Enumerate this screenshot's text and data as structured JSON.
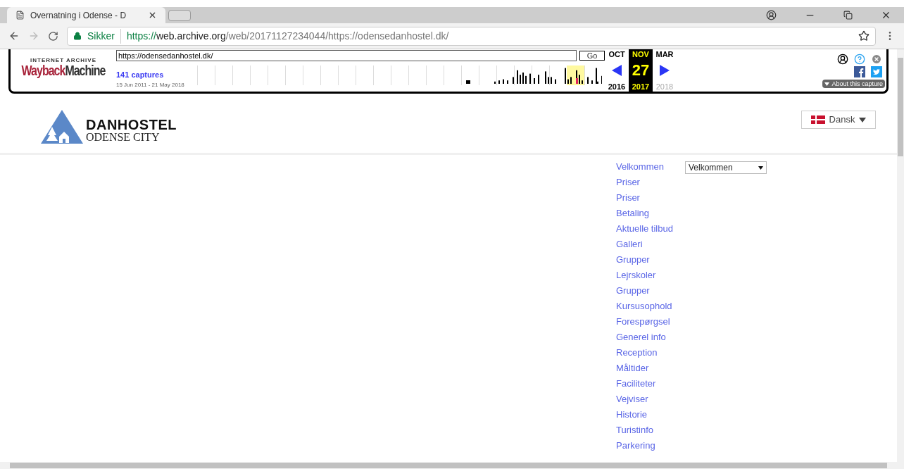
{
  "browser": {
    "tab": {
      "title": "Overnatning i Odense - D"
    },
    "address": {
      "security": "Sikker",
      "scheme": "https://",
      "host": "web.archive.org",
      "path": "/web/20171127234044/https://odensedanhostel.dk/"
    }
  },
  "wayback": {
    "logo_top": "INTERNET ARCHIVE",
    "logo_main": "WaybackMachine",
    "url": "https://odensedanhostel.dk/",
    "go": "Go",
    "captures": "141 captures",
    "range": "15 Jun 2011 - 21 May 2018",
    "calendar": [
      {
        "month": "OCT",
        "year": "2016",
        "selected": false,
        "disabled": false
      },
      {
        "month": "NOV",
        "day": "27",
        "year": "2017",
        "selected": true,
        "disabled": false
      },
      {
        "month": "MAR",
        "year": "2018",
        "selected": false,
        "disabled": true
      }
    ],
    "about": "About this capture"
  },
  "site": {
    "brand": "DANHOSTEL",
    "subtitle": "ODENSE CITY",
    "language": "Dansk",
    "select": "Velkommen",
    "nav": [
      "Velkommen",
      "Priser",
      "Priser",
      "Betaling",
      "Aktuelle tilbud",
      "Galleri",
      "Grupper",
      "Lejrskoler",
      "Grupper",
      "Kursusophold",
      "Forespørgsel",
      "Generel info",
      "Reception",
      "Måltider",
      "Faciliteter",
      "Vejviser",
      "Historie",
      "Turistinfo",
      "Parkering"
    ]
  }
}
